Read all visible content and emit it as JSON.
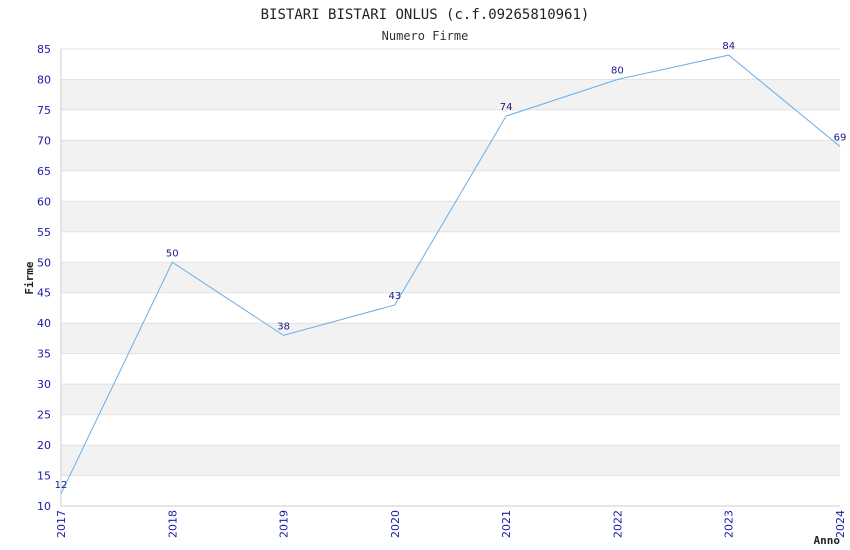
{
  "chart_data": {
    "type": "line",
    "title": "BISTARI BISTARI ONLUS (c.f.09265810961)",
    "subtitle": "Numero Firme",
    "xlabel": "Anno",
    "ylabel": "Firme",
    "x": [
      "2017",
      "2018",
      "2019",
      "2020",
      "2021",
      "2022",
      "2023",
      "2024"
    ],
    "values": [
      12,
      50,
      38,
      43,
      74,
      80,
      84,
      69
    ],
    "ylim": [
      10,
      85
    ],
    "yticks": [
      10,
      15,
      20,
      25,
      30,
      35,
      40,
      45,
      50,
      55,
      60,
      65,
      70,
      75,
      80,
      85
    ],
    "grid": "horizontal bands",
    "line_color": "#6aaee8",
    "band_color": "#f2f2f2",
    "tick_color": "#1a1aaa"
  }
}
